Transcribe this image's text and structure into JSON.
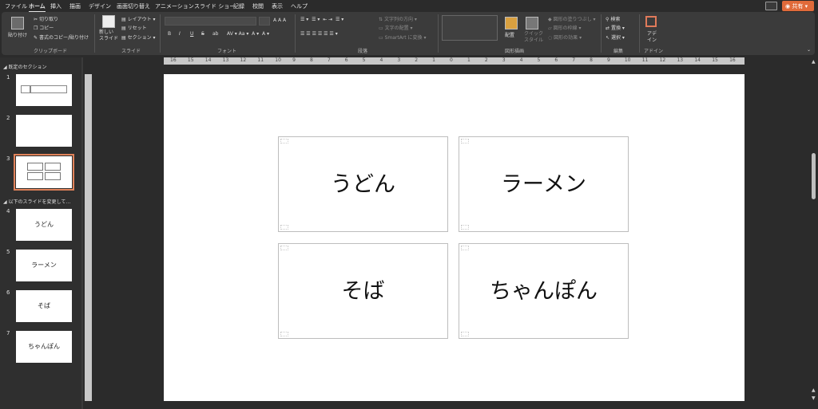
{
  "tabs": [
    "ファイル",
    "ホーム",
    "挿入",
    "描画",
    "デザイン",
    "画面切り替え",
    "アニメーション",
    "スライド ショー",
    "記録",
    "校閲",
    "表示",
    "ヘルプ"
  ],
  "share_label": "共有",
  "ribbon": {
    "clipboard": {
      "paste": "貼り付け",
      "cut": "切り取り",
      "copy": "コピー",
      "format_painter": "書式のコピー/貼り付け",
      "label": "クリップボード"
    },
    "slides": {
      "new_slide": "新しい\nスライド",
      "layout": "レイアウト",
      "reset": "リセット",
      "section": "セクション",
      "label": "スライド"
    },
    "font": {
      "label": "フォント",
      "bold": "B",
      "italic": "I",
      "underline": "U",
      "strike": "S",
      "shadow": "ab"
    },
    "paragraph": {
      "text_direction": "文字列の方向",
      "align_text": "文字の配置",
      "smartart": "SmartArt に変換",
      "label": "段落"
    },
    "drawing": {
      "arrange": "配置",
      "quick_styles": "クイック\nスタイル",
      "shape_fill": "図形の塗りつぶし",
      "shape_outline": "図形の枠線",
      "shape_effects": "図形の効果",
      "label": "図形描画"
    },
    "editing": {
      "find": "検索",
      "replace": "置換",
      "select": "選択",
      "label": "編集"
    },
    "designer": {
      "label": "アデ\nイン",
      "group": "アドイン"
    }
  },
  "sections": [
    "既定のセクション",
    "以下のスライドを変更して…"
  ],
  "thumbnails": [
    {
      "num": "1",
      "label": ""
    },
    {
      "num": "2",
      "label": ""
    },
    {
      "num": "3",
      "label": ""
    },
    {
      "num": "4",
      "label": "うどん"
    },
    {
      "num": "5",
      "label": "ラーメン"
    },
    {
      "num": "6",
      "label": "そば"
    },
    {
      "num": "7",
      "label": "ちゃんぽん"
    }
  ],
  "ruler_numbers": [
    "16",
    "15",
    "14",
    "13",
    "12",
    "11",
    "10",
    "9",
    "8",
    "7",
    "6",
    "5",
    "4",
    "3",
    "2",
    "1",
    "0",
    "1",
    "2",
    "3",
    "4",
    "5",
    "6",
    "7",
    "8",
    "9",
    "10",
    "11",
    "12",
    "13",
    "14",
    "15",
    "16"
  ],
  "cards": [
    "うどん",
    "ラーメン",
    "そば",
    "ちゃんぽん"
  ],
  "colors": {
    "accent": "#e0825a",
    "share": "#e06a3a"
  }
}
